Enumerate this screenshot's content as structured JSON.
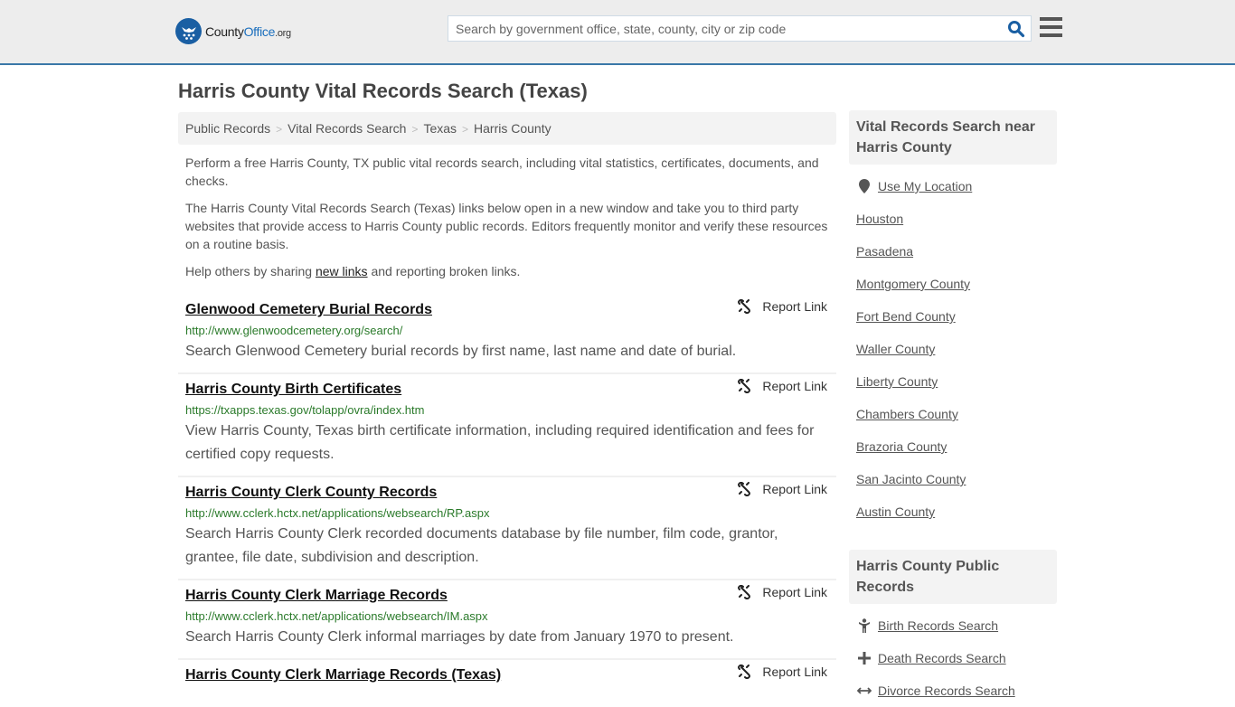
{
  "header": {
    "logo": {
      "county": "County",
      "office": "Office",
      "org": ".org"
    },
    "search": {
      "placeholder": "Search by government office, state, county, city or zip code",
      "value": ""
    }
  },
  "page_title": "Harris County Vital Records Search (Texas)",
  "breadcrumb": [
    "Public Records",
    "Vital Records Search",
    "Texas",
    "Harris County"
  ],
  "intro": {
    "p1": "Perform a free Harris County, TX public vital records search, including vital statistics, certificates, documents, and checks.",
    "p2": "The Harris County Vital Records Search (Texas) links below open in a new window and take you to third party websites that provide access to Harris County public records. Editors frequently monitor and verify these resources on a routine basis.",
    "p3_before": "Help others by sharing ",
    "p3_link": "new links",
    "p3_after": " and reporting broken links."
  },
  "report_label": "Report Link",
  "results": [
    {
      "title": "Glenwood Cemetery Burial Records",
      "url": "http://www.glenwoodcemetery.org/search/",
      "desc": "Search Glenwood Cemetery burial records by first name, last name and date of burial."
    },
    {
      "title": "Harris County Birth Certificates",
      "url": "https://txapps.texas.gov/tolapp/ovra/index.htm",
      "desc": "View Harris County, Texas birth certificate information, including required identification and fees for certified copy requests."
    },
    {
      "title": "Harris County Clerk County Records",
      "url": "http://www.cclerk.hctx.net/applications/websearch/RP.aspx",
      "desc": "Search Harris County Clerk recorded documents database by file number, film code, grantor, grantee, file date, subdivision and description."
    },
    {
      "title": "Harris County Clerk Marriage Records",
      "url": "http://www.cclerk.hctx.net/applications/websearch/IM.aspx",
      "desc": "Search Harris County Clerk informal marriages by date from January 1970 to present."
    },
    {
      "title": "Harris County Clerk Marriage Records (Texas)",
      "url": "",
      "desc": ""
    }
  ],
  "sidebar": {
    "nearby": {
      "heading": "Vital Records Search near Harris County",
      "use_location": "Use My Location",
      "items": [
        "Houston",
        "Pasadena",
        "Montgomery County",
        "Fort Bend County",
        "Waller County",
        "Liberty County",
        "Chambers County",
        "Brazoria County",
        "San Jacinto County",
        "Austin County"
      ]
    },
    "public_records": {
      "heading": "Harris County Public Records",
      "items": [
        {
          "label": "Birth Records Search",
          "icon": "child-icon"
        },
        {
          "label": "Death Records Search",
          "icon": "cross-icon"
        },
        {
          "label": "Divorce Records Search",
          "icon": "arrows-horizontal-icon"
        }
      ]
    }
  }
}
